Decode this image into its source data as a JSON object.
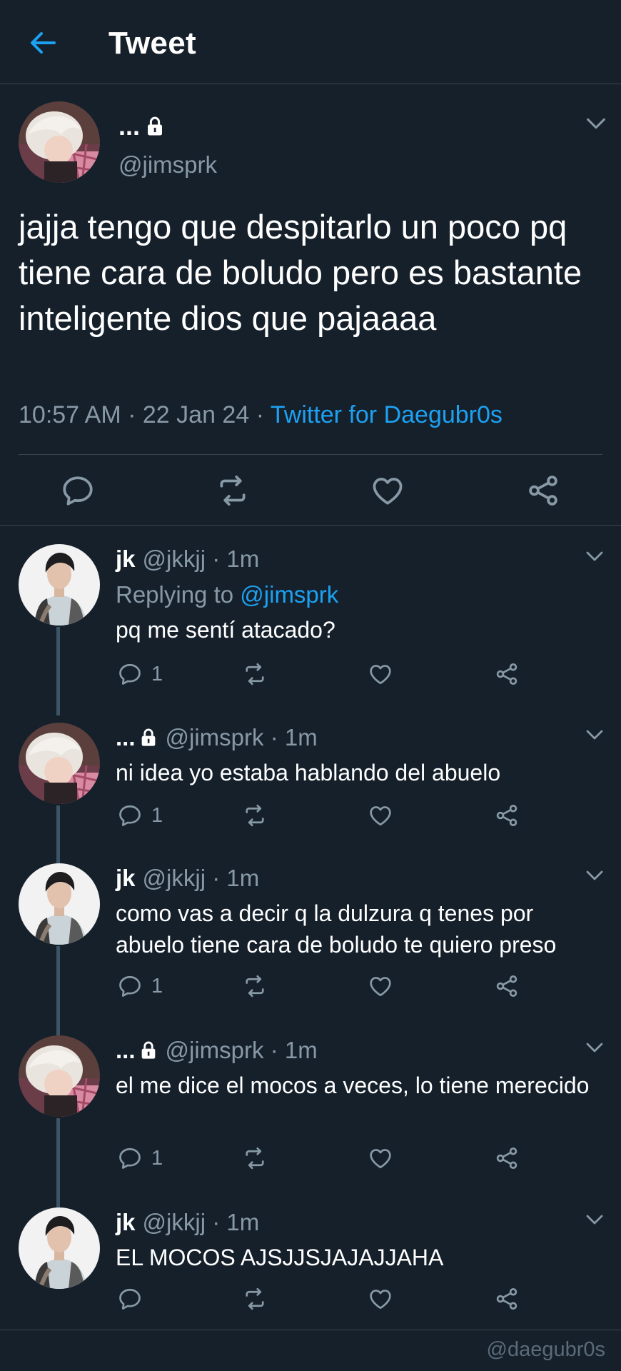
{
  "header": {
    "title": "Tweet",
    "back_icon": "arrow-left-icon"
  },
  "colors": {
    "background": "#15202b",
    "accent": "#1da1f2",
    "muted": "#8899a6",
    "border": "#38444d"
  },
  "main_tweet": {
    "display_name": "...",
    "handle": "@jimsprk",
    "text": "jajja tengo que despitarlo un poco pq tiene cara de boludo pero es bastante inteligente dios que pajaaaa",
    "time": "10:57 AM",
    "date": "22 Jan 24",
    "source": "Twitter for Daegubr0s"
  },
  "replies": [
    {
      "name": "jk",
      "handle": "@jkkjj",
      "time": "1m",
      "replying_label": "Replying to",
      "replying_to": "@jimsprk",
      "text": "pq me sentí atacado?",
      "reply_count": "1"
    },
    {
      "name": "...",
      "handle": "@jimsprk",
      "time": "1m",
      "text": "ni idea yo estaba hablando del abuelo",
      "reply_count": "1"
    },
    {
      "name": "jk",
      "handle": "@jkkjj",
      "time": "1m",
      "text": "como vas a decir q la dulzura q tenes por abuelo tiene cara de boludo te quiero preso",
      "reply_count": "1"
    },
    {
      "name": "...",
      "handle": "@jimsprk",
      "time": "1m",
      "text": "el me dice el mocos a veces, lo tiene merecido",
      "reply_count": "1"
    },
    {
      "name": "jk",
      "handle": "@jkkjj",
      "time": "1m",
      "text": "EL MOCOS AJSJJSJAJAJJAHA",
      "reply_count": ""
    }
  ],
  "separator": "·",
  "watermark": "@daegubr0s"
}
